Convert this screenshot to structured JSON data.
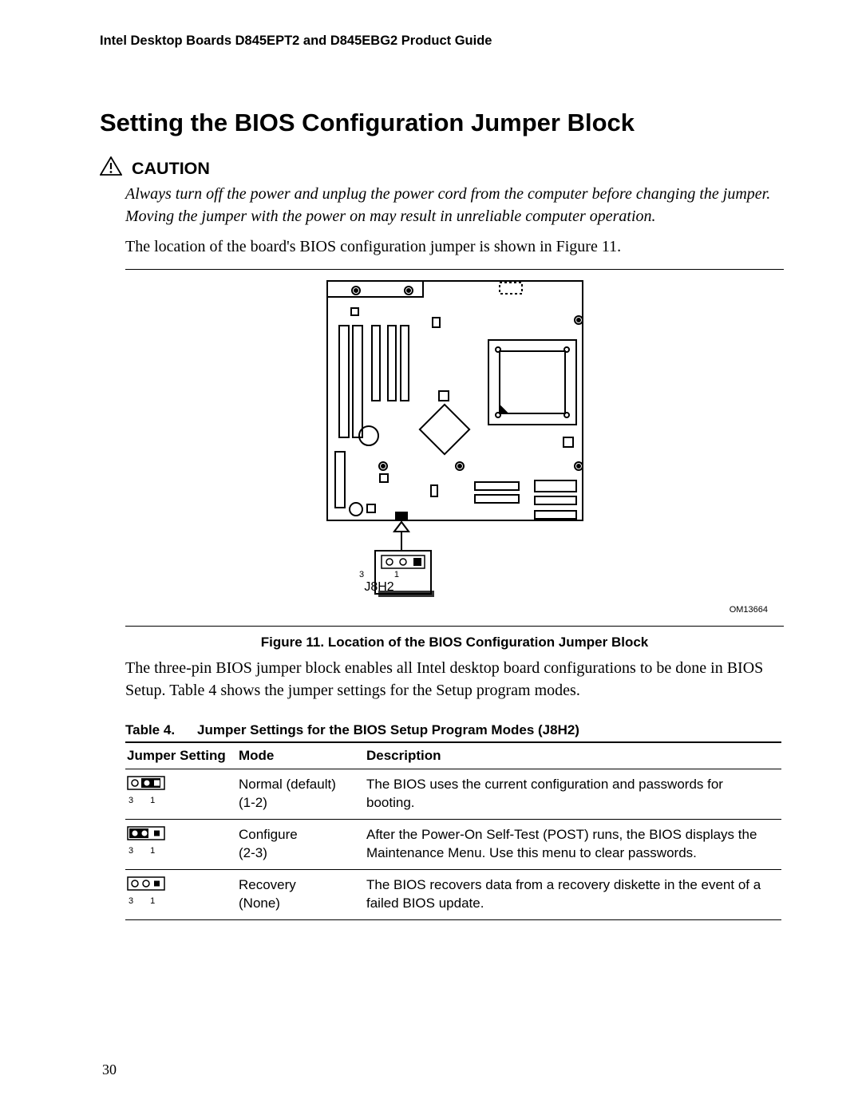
{
  "running_head": "Intel Desktop Boards D845EPT2 and D845EBG2 Product Guide",
  "section_title": "Setting the BIOS Configuration Jumper Block",
  "caution": {
    "label": "CAUTION",
    "text": "Always turn off the power and unplug the power cord from the computer before changing the jumper.  Moving the jumper with the power on may result in unreliable computer operation."
  },
  "intro_text": "The location of the board's BIOS configuration jumper is shown in Figure 11.",
  "figure": {
    "caption": "Figure 11.  Location of the BIOS Configuration Jumper Block",
    "om_number": "OM13664",
    "callout": {
      "pin3": "3",
      "pin1": "1",
      "label": "J8H2"
    }
  },
  "post_fig_text": "The three-pin BIOS jumper block enables all Intel desktop board configurations to be done in BIOS Setup.  Table 4 shows the jumper settings for the Setup program modes.",
  "table": {
    "caption_prefix": "Table 4.",
    "caption_text": "Jumper Settings for the BIOS Setup Program Modes (J8H2)",
    "headers": [
      "Jumper Setting",
      "Mode",
      "Description"
    ],
    "rows": [
      {
        "jumper": {
          "pins": "1-2",
          "pin_left": "3",
          "pin_right": "1"
        },
        "mode_line1": "Normal (default)",
        "mode_line2": "(1-2)",
        "desc": "The BIOS uses the current configuration and passwords for booting."
      },
      {
        "jumper": {
          "pins": "2-3",
          "pin_left": "3",
          "pin_right": "1"
        },
        "mode_line1": "Configure",
        "mode_line2": "(2-3)",
        "desc": "After the Power-On Self-Test (POST) runs, the BIOS displays the Maintenance Menu.  Use this menu to clear passwords."
      },
      {
        "jumper": {
          "pins": "none",
          "pin_left": "3",
          "pin_right": "1"
        },
        "mode_line1": "Recovery",
        "mode_line2": "(None)",
        "desc": "The BIOS recovers data from a recovery diskette in the event of a failed BIOS update."
      }
    ]
  },
  "page_number": "30"
}
